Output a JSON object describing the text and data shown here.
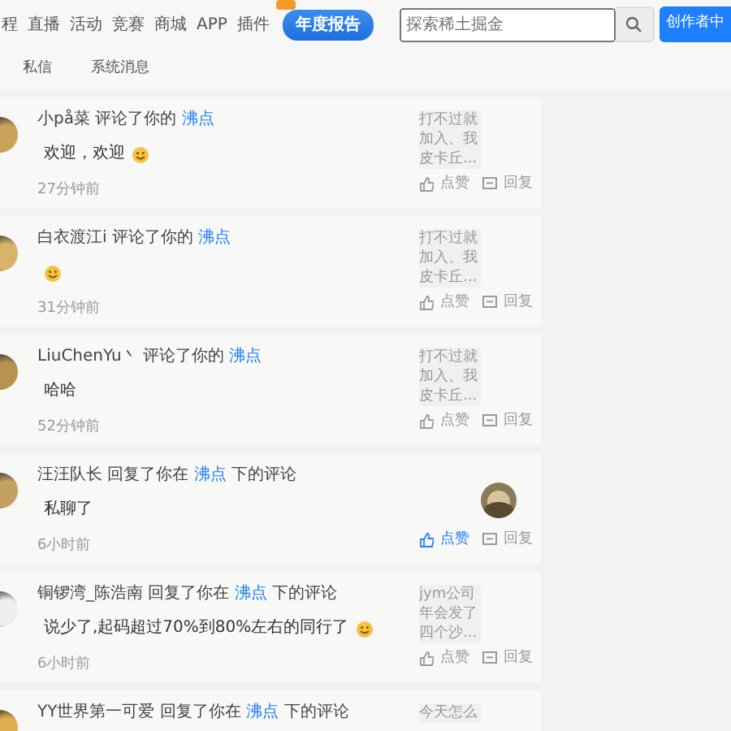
{
  "nav": {
    "items": [
      {
        "label": "程"
      },
      {
        "label": "直播"
      },
      {
        "label": "活动"
      },
      {
        "label": "竞赛"
      },
      {
        "label": "商城"
      },
      {
        "label": "APP"
      },
      {
        "label": "插件"
      }
    ],
    "badge": "年度报告",
    "search": {
      "placeholder": "探索稀土掘金"
    },
    "creator_button": "创作者中"
  },
  "tabs": [
    {
      "label": "私信",
      "selected": false
    },
    {
      "label": "系统消息",
      "selected": false
    }
  ],
  "notifications": [
    {
      "user": "小på菜",
      "action": "评论了你的",
      "link": "沸点",
      "content": "欢迎，欢迎",
      "emoji": true,
      "time": "27分钟前",
      "quote": [
        "打不过就",
        "加入、我",
        "皮卡丘..."
      ],
      "like": "点赞",
      "liked": false,
      "reply": "回复"
    },
    {
      "user": "白衣渡江i",
      "action": "评论了你的",
      "link": "沸点",
      "emoji": true,
      "time": "31分钟前",
      "quote": [
        "打不过就",
        "加入、我",
        "皮卡丘..."
      ],
      "like": "点赞",
      "liked": false,
      "reply": "回复"
    },
    {
      "user": "LiuChenYu丶",
      "action": "评论了你的",
      "link": "沸点",
      "content": "哈哈",
      "emoji": false,
      "time": "52分钟前",
      "quote": [
        "打不过就",
        "加入、我",
        "皮卡丘..."
      ],
      "like": "点赞",
      "liked": false,
      "reply": "回复"
    },
    {
      "user": "汪汪队长",
      "action": "回复了你在",
      "link": "沸点",
      "suffix": "下的评论",
      "content": "私聊了",
      "emoji": false,
      "time": "6小时前",
      "like": "点赞",
      "liked": true,
      "reply": "回复"
    },
    {
      "user": "铜锣湾_陈浩南",
      "action": "回复了你在",
      "link": "沸点",
      "suffix": "下的评论",
      "content": "说少了,起码超过70%到80%左右的同行了",
      "emoji": true,
      "time": "6小时前",
      "quote": [
        "jym公司",
        "年会发了",
        "四个沙..."
      ],
      "like": "点赞",
      "liked": false,
      "reply": "回复"
    },
    {
      "user": "YY世界第一可爱",
      "action": "回复了你在",
      "link": "沸点",
      "suffix": "下的评论",
      "quote": [
        "今天怎么"
      ]
    }
  ]
}
